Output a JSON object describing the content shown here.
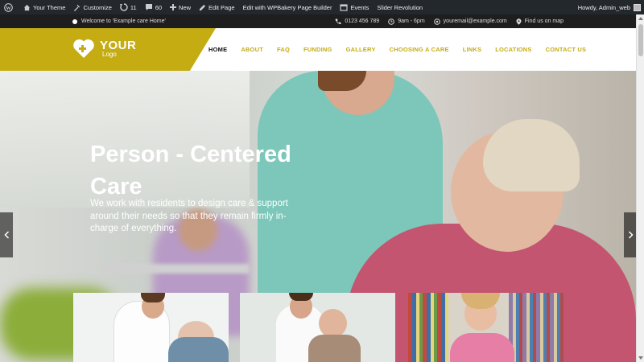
{
  "adminbar": {
    "site_name": "Your Theme",
    "customize": "Customize",
    "updates_count": "11",
    "comments_count": "60",
    "new_label": "New",
    "edit_page": "Edit Page",
    "wpbakery": "Edit with WPBakery Page Builder",
    "events": "Events",
    "slider": "Slider Revolution",
    "howdy": "Howdy, Admin_web"
  },
  "topbar": {
    "welcome": "Welcome to 'Example care Home'",
    "phone": "0123 456 789",
    "hours": "9am - 6pm",
    "email": "youremail@example.com",
    "map": "Find us on map"
  },
  "logo": {
    "big": "YOUR",
    "small": "Logo"
  },
  "nav": [
    "HOME",
    "ABOUT",
    "FAQ",
    "FUNDING",
    "GALLERY",
    "CHOOSING A CARE",
    "LINKS",
    "LOCATIONS",
    "CONTACT US"
  ],
  "hero": {
    "title": "Person - Centered Care",
    "text": "We work with residents to design care & support around their needs so that they remain firmly in-charge of everything."
  },
  "colors": {
    "accent": "#c5ac13",
    "adminbar": "#23282d",
    "topbar": "#1e1e1e"
  },
  "icons": [
    "wordpress-icon",
    "home-icon",
    "customize-icon",
    "updates-icon",
    "comments-icon",
    "plus-icon",
    "edit-icon",
    "calendar-icon",
    "phone-icon",
    "clock-icon",
    "email-icon",
    "map-pin-icon",
    "heart-plus-icon",
    "chevron-left-icon",
    "chevron-right-icon"
  ]
}
